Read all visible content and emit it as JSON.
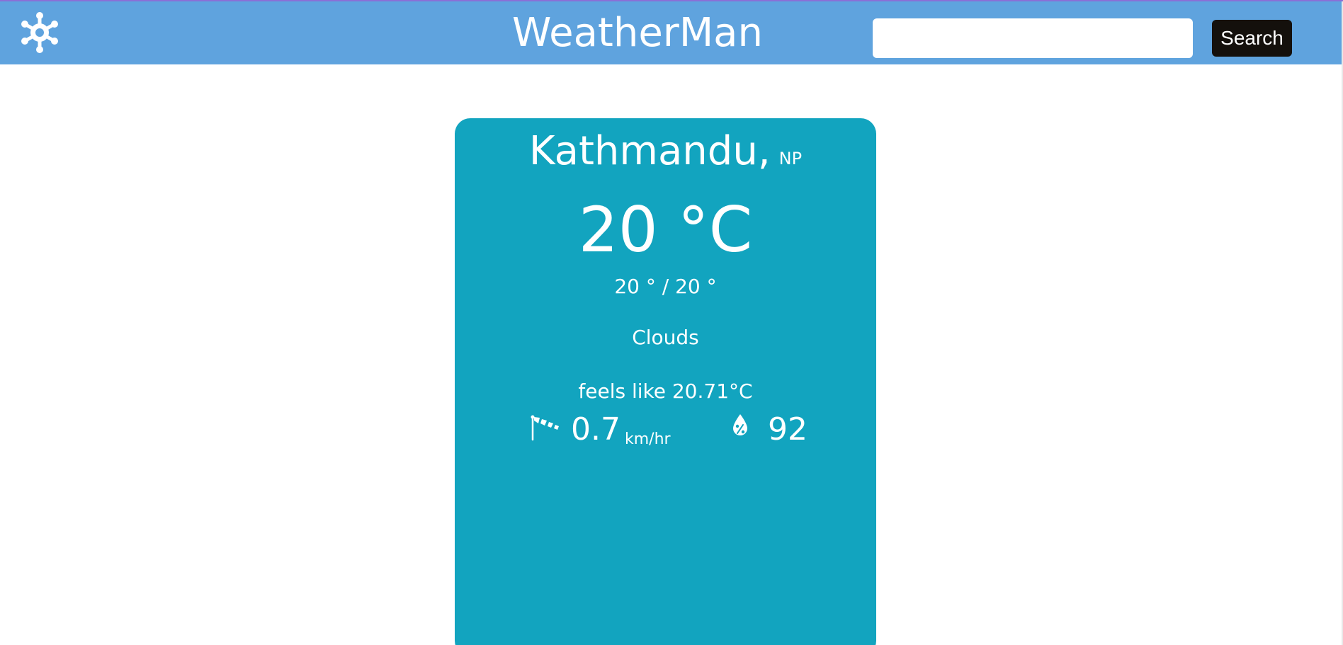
{
  "header": {
    "title": "WeatherMan",
    "logo_icon": "snowflake-icon",
    "search": {
      "value": "",
      "placeholder": ""
    },
    "search_button_label": "Search",
    "background_color": "#5fa3de"
  },
  "weather": {
    "city": "Kathmandu,",
    "country": "NP",
    "temperature": "20 °C",
    "min_max": "20 ° / 20 °",
    "condition": "Clouds",
    "feels_like": "feels like 20.71°C",
    "wind_icon": "windsock-icon",
    "wind_speed": "0.7",
    "wind_unit": "km/hr",
    "humidity_icon": "humidity-drop-icon",
    "humidity": "92",
    "card_color": "#12a4bf"
  }
}
